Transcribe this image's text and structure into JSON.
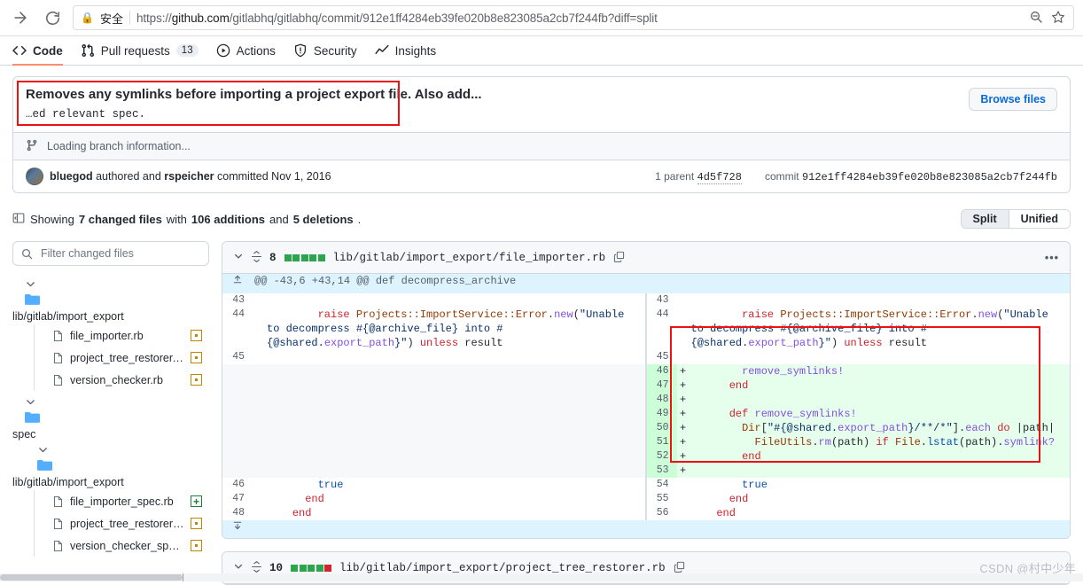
{
  "browser": {
    "secure_label": "安全",
    "url_prefix": "https://",
    "url_domain": "github.com",
    "url_path": "/gitlabhq/gitlabhq/commit/912e1ff4284eb39fe020b8e823085a2cb7f244fb?diff=split",
    "forward_icon": "arrow-forward-icon",
    "reload_icon": "reload-icon",
    "zoom_out_icon": "zoom-out-icon",
    "bookmark_icon": "star-icon"
  },
  "repo_nav": {
    "tabs": [
      {
        "label": "Code",
        "icon": "code-icon",
        "count": "",
        "active": true
      },
      {
        "label": "Pull requests",
        "icon": "git-pull-request-icon",
        "count": "13",
        "active": false
      },
      {
        "label": "Actions",
        "icon": "play-icon",
        "count": "",
        "active": false
      },
      {
        "label": "Security",
        "icon": "shield-icon",
        "count": "",
        "active": false
      },
      {
        "label": "Insights",
        "icon": "graph-icon",
        "count": "",
        "active": false
      }
    ]
  },
  "commit": {
    "title": "Removes any symlinks before importing a project export file. Also add...",
    "description": "…ed relevant spec.",
    "browse_files_label": "Browse files",
    "branch_status": "Loading branch information...",
    "author": "bluegod",
    "authored_text": "authored and",
    "committer": "rspeicher",
    "committed_text": "committed",
    "date": "Nov 1, 2016",
    "parent_label": "1 parent",
    "parent_sha": "4d5f728",
    "commit_label": "commit",
    "commit_sha": "912e1ff4284eb39fe020b8e823085a2cb7f244fb"
  },
  "files_bar": {
    "showing": "Showing",
    "changed_files": "7 changed files",
    "with": "with",
    "additions": "106 additions",
    "and": "and",
    "deletions": "5 deletions",
    "period": ".",
    "toggle": [
      {
        "label": "Split",
        "selected": true
      },
      {
        "label": "Unified",
        "selected": false
      }
    ]
  },
  "sidebar": {
    "filter_placeholder": "Filter changed files",
    "search_icon": "search-icon",
    "groups": [
      {
        "folder": "lib/gitlab/import_export",
        "files": [
          {
            "name": "file_importer.rb",
            "status": "modified"
          },
          {
            "name": "project_tree_restorer.rb",
            "status": "modified"
          },
          {
            "name": "version_checker.rb",
            "status": "modified"
          }
        ]
      },
      {
        "folder": "spec",
        "files": []
      },
      {
        "folder": "lib/gitlab/import_export",
        "files": [
          {
            "name": "file_importer_spec.rb",
            "status": "added"
          },
          {
            "name": "project_tree_restorer_sp...",
            "status": "modified"
          },
          {
            "name": "version_checker_spec.rb",
            "status": "modified"
          }
        ]
      }
    ]
  },
  "diffs": [
    {
      "changes_count": "8",
      "blocks": [
        "g",
        "g",
        "g",
        "g",
        "g"
      ],
      "path": "lib/gitlab/import_export/file_importer.rb",
      "copy_icon": "copy-icon",
      "kebab_icon": "kebab-menu-icon",
      "hunk_header": "@@ -43,6 +43,14 @@ def decompress_archive",
      "rows": [
        {
          "type": "context",
          "lno_l": "43",
          "lno_r": "43",
          "code": ""
        },
        {
          "type": "context",
          "lno_l": "44",
          "lno_r": "44",
          "code": "        raise Projects::ImportService::Error.new(\"Unable to decompress #{@archive_file} into #{@shared.export_path}\") unless result"
        },
        {
          "type": "context",
          "lno_l": "45",
          "lno_r": "45",
          "code": ""
        },
        {
          "type": "added",
          "lno_r": "46",
          "code": "        remove_symlinks!"
        },
        {
          "type": "added",
          "lno_r": "47",
          "code": "      end"
        },
        {
          "type": "added",
          "lno_r": "48",
          "code": ""
        },
        {
          "type": "added",
          "lno_r": "49",
          "code": "      def remove_symlinks!"
        },
        {
          "type": "added",
          "lno_r": "50",
          "code": "        Dir[\"#{@shared.export_path}/**/*\"].each do |path|"
        },
        {
          "type": "added",
          "lno_r": "51",
          "code": "          FileUtils.rm(path) if File.lstat(path).symlink?"
        },
        {
          "type": "added",
          "lno_r": "52",
          "code": "        end"
        },
        {
          "type": "added",
          "lno_r": "53",
          "code": ""
        },
        {
          "type": "context",
          "lno_l": "46",
          "lno_r": "54",
          "code": "        true"
        },
        {
          "type": "context",
          "lno_l": "47",
          "lno_r": "55",
          "code": "      end"
        },
        {
          "type": "context",
          "lno_l": "48",
          "lno_r": "56",
          "code": "    end"
        }
      ]
    },
    {
      "changes_count": "10",
      "blocks": [
        "g",
        "g",
        "g",
        "g",
        "r"
      ],
      "path": "lib/gitlab/import_export/project_tree_restorer.rb",
      "copy_icon": "copy-icon",
      "kebab_icon": "kebab-menu-icon"
    }
  ],
  "watermark": "CSDN @村中少年"
}
